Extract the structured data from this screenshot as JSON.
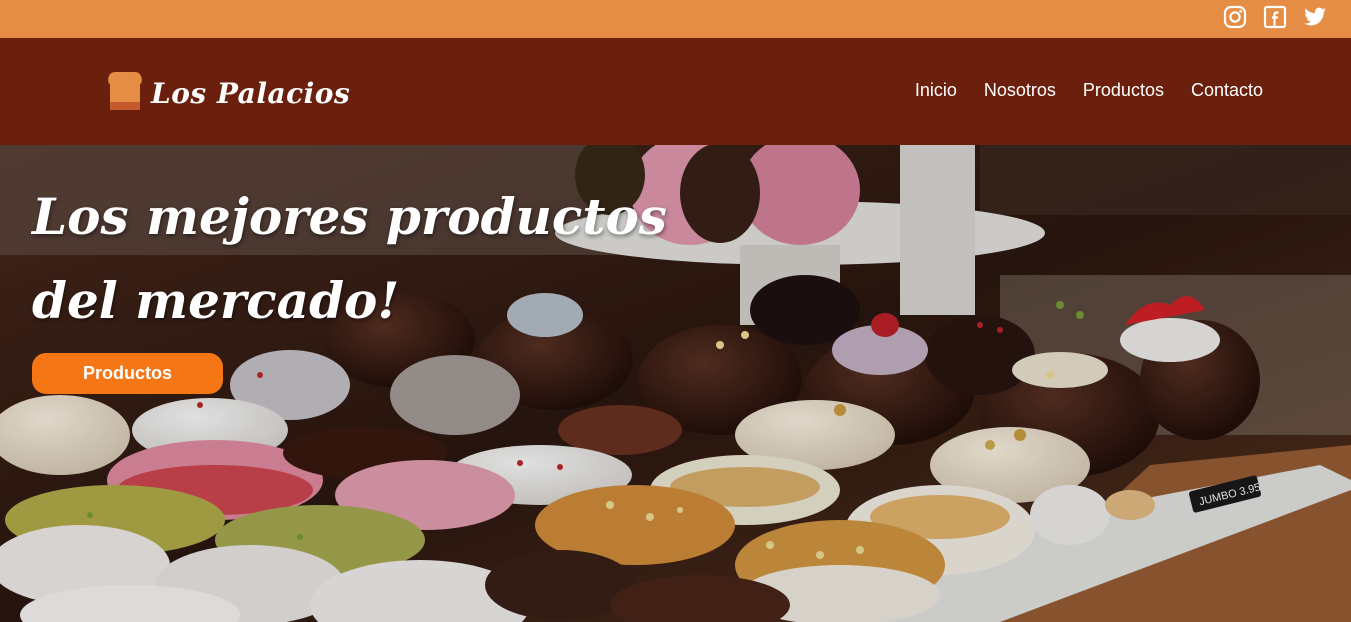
{
  "topbar": {
    "social": [
      {
        "icon": "instagram-icon"
      },
      {
        "icon": "facebook-icon"
      },
      {
        "icon": "twitter-icon"
      }
    ]
  },
  "brand": {
    "name": "Los Palacios",
    "icon": "bread-icon"
  },
  "nav": {
    "items": [
      "Inicio",
      "Nosotros",
      "Productos",
      "Contacto"
    ]
  },
  "hero": {
    "title_line1": "Los mejores productos",
    "title_line2": "del mercado!",
    "button_label": "Productos",
    "price_tag": "JUMBO 3.95"
  },
  "colors": {
    "topbar": "#e58c45",
    "navbar": "#6a200c",
    "accent_button": "#f57615"
  }
}
